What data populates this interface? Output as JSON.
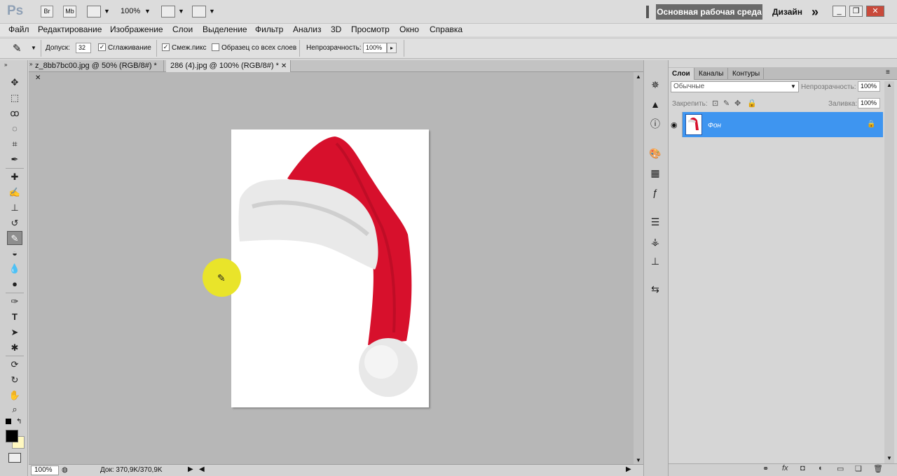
{
  "app": {
    "logo": "Ps",
    "br": "Br",
    "mb": "Mb",
    "zoom": "100%",
    "workspace": "Основная рабочая среда",
    "design": "Дизайн"
  },
  "menu": [
    "Файл",
    "Редактирование",
    "Изображение",
    "Слои",
    "Выделение",
    "Фильтр",
    "Анализ",
    "3D",
    "Просмотр",
    "Окно",
    "Справка"
  ],
  "options": {
    "tolerance_label": "Допуск:",
    "tolerance_value": "32",
    "antialias_label": "Сглаживание",
    "contiguous_label": "Смеж.пикс",
    "sample_all_label": "Образец со всех слоев",
    "opacity_label": "Непрозрачность:",
    "opacity_value": "100%"
  },
  "tabs": [
    {
      "label": "z_8bb7bc00.jpg @ 50% (RGB/8#) *",
      "active": false
    },
    {
      "label": "286 (4).jpg @ 100% (RGB/8#) *",
      "active": true
    }
  ],
  "status": {
    "zoom": "100%",
    "doc": "Док: 370,9K/370,9K"
  },
  "layers_panel": {
    "tabs": [
      "Слои",
      "Каналы",
      "Контуры"
    ],
    "blend_mode": "Обычные",
    "opacity_label": "Непрозрачность:",
    "opacity_value": "100%",
    "lock_label": "Закрепить:",
    "fill_label": "Заливка:",
    "fill_value": "100%",
    "layer_name": "Фон"
  },
  "colors": {
    "accent": "#3e95f0",
    "hat_red": "#d7102c",
    "fur": "#eaeaea",
    "highlight": "#e9e42a"
  }
}
